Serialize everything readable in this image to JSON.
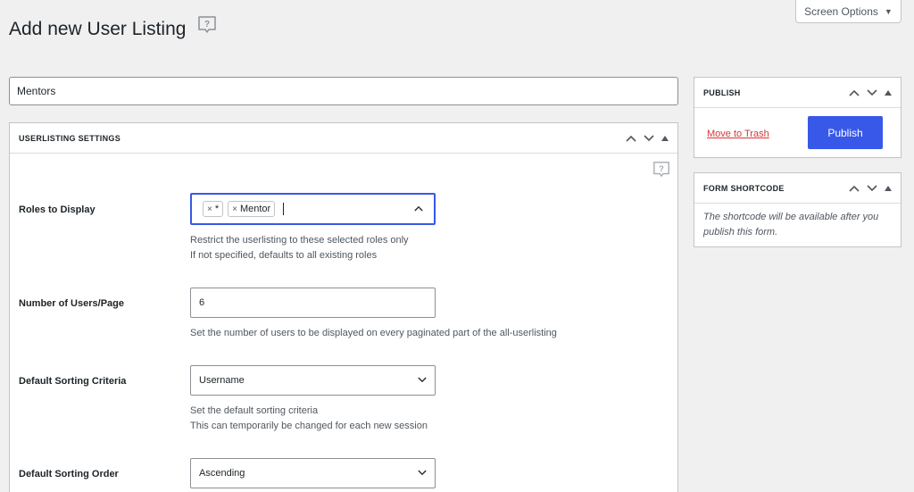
{
  "header": {
    "screen_options_label": "Screen Options",
    "page_title": "Add new User Listing"
  },
  "title_input": {
    "value": "Mentors"
  },
  "settings_box": {
    "title": "USERLISTING SETTINGS",
    "fields": {
      "roles": {
        "label": "Roles to Display",
        "tags": [
          "*",
          "Mentor"
        ],
        "desc_line1": "Restrict the userlisting to these selected roles only",
        "desc_line2": "If not specified, defaults to all existing roles"
      },
      "users_per_page": {
        "label": "Number of Users/Page",
        "value": "6",
        "desc": "Set the number of users to be displayed on every paginated part of the all-userlisting"
      },
      "sorting_criteria": {
        "label": "Default Sorting Criteria",
        "value": "Username",
        "desc_line1": "Set the default sorting criteria",
        "desc_line2": "This can temporarily be changed for each new session"
      },
      "sorting_order": {
        "label": "Default Sorting Order",
        "value": "Ascending"
      }
    }
  },
  "publish_box": {
    "title": "PUBLISH",
    "trash_label": "Move to Trash",
    "publish_label": "Publish"
  },
  "shortcode_box": {
    "title": "FORM SHORTCODE",
    "text": "The shortcode will be available after you publish this form."
  },
  "icons": {
    "help": "help-speech-bubble-icon",
    "up": "chevron-up-icon",
    "down": "chevron-down-icon",
    "toggle": "triangle-up-icon",
    "remove": "close-icon"
  },
  "colors": {
    "primary": "#3858e9",
    "danger": "#d63638",
    "background": "#f0f0f1"
  }
}
